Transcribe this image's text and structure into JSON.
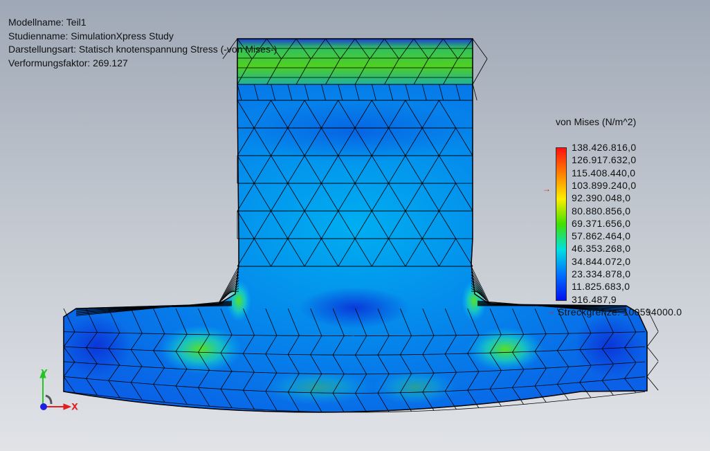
{
  "info": {
    "model_name": "Modellname: Teil1",
    "study_name": "Studienname: SimulationXpress Study",
    "plot_type": "Darstellungsart: Statisch knotenspannung Stress (-von Mises-)",
    "deformation_scale": "Verformungsfaktor: 269.127"
  },
  "legend": {
    "title": "von Mises (N/m^2)",
    "values": [
      "138.426.816,0",
      "126.917.632,0",
      "115.408.440,0",
      "103.899.240,0",
      "92.390.048,0",
      "80.880.856,0",
      "69.371.656,0",
      "57.862.464,0",
      "46.353.268,0",
      "34.844.072,0",
      "23.334.878,0",
      "11.825.683,0",
      "316.487,9"
    ],
    "yield_strength": "Streckgrenze: 100594000.0",
    "colors": [
      "#ff1010",
      "#ff8000",
      "#ffee00",
      "#40e000",
      "#00e0e0",
      "#0070ff",
      "#0010ee"
    ]
  },
  "triad": {
    "y_label": "Y",
    "x_label": "X",
    "y_color": "#22c522",
    "x_color": "#e02020",
    "z_color": "#2020e0"
  }
}
